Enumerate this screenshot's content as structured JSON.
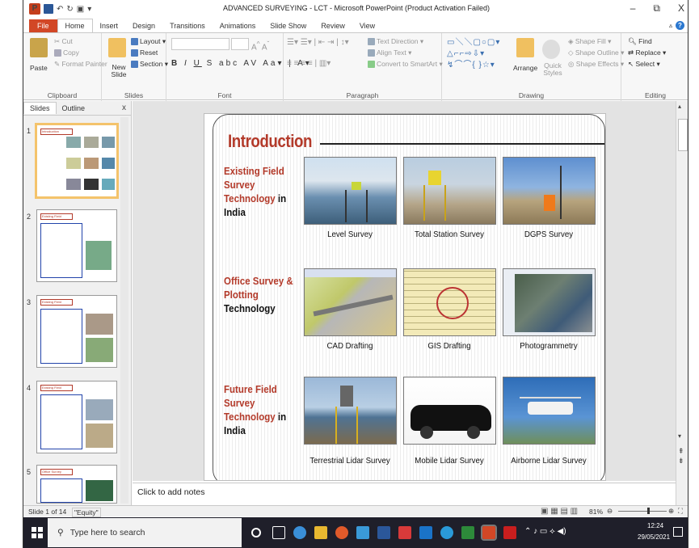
{
  "window": {
    "title": "ADVANCED SURVEYING - LCT - Microsoft PowerPoint (Product Activation Failed)",
    "minimize": "–",
    "restore": "⧉",
    "close": "X"
  },
  "tabs": [
    "File",
    "Home",
    "Insert",
    "Design",
    "Transitions",
    "Animations",
    "Slide Show",
    "Review",
    "View"
  ],
  "ribbon": {
    "clipboard": {
      "paste": "Paste",
      "cut": "Cut",
      "copy": "Copy",
      "format_painter": "Format Painter",
      "label": "Clipboard"
    },
    "slides": {
      "new_slide": "New Slide",
      "layout": "Layout",
      "reset": "Reset",
      "section": "Section",
      "label": "Slides"
    },
    "font": {
      "label": "Font",
      "grow": "A",
      "shrink": "A"
    },
    "paragraph": {
      "label": "Paragraph",
      "text_direction": "Text Direction",
      "align_text": "Align Text",
      "convert_smartart": "Convert to SmartArt"
    },
    "drawing": {
      "label": "Drawing",
      "arrange": "Arrange",
      "quick_styles": "Quick Styles",
      "shape_fill": "Shape Fill",
      "shape_outline": "Shape Outline",
      "shape_effects": "Shape Effects"
    },
    "editing": {
      "label": "Editing",
      "find": "Find",
      "replace": "Replace",
      "select": "Select"
    }
  },
  "panel": {
    "tabs": [
      "Slides",
      "Outline"
    ],
    "close": "x",
    "thumbnails": [
      {
        "num": "1",
        "title": "Introduction"
      },
      {
        "num": "2",
        "title": "Existing Field Survey"
      },
      {
        "num": "3",
        "title": "Existing Field Survey"
      },
      {
        "num": "4",
        "title": "Existing Field Survey"
      },
      {
        "num": "5",
        "title": "Office Survey"
      }
    ]
  },
  "slide": {
    "title": "Introduction",
    "rows": [
      {
        "label_red": "Existing Field Survey Technology",
        "label_black": " in India",
        "items": [
          {
            "caption": "Level Survey",
            "icon": "level-survey-photo"
          },
          {
            "caption": "Total Station Survey",
            "icon": "total-station-photo"
          },
          {
            "caption": "DGPS Survey",
            "icon": "dgps-survey-photo"
          }
        ]
      },
      {
        "label_red": "Office Survey & Plotting",
        "label_black": " Technology",
        "items": [
          {
            "caption": "CAD Drafting",
            "icon": "cad-drafting-image"
          },
          {
            "caption": "GIS Drafting",
            "icon": "gis-drafting-image"
          },
          {
            "caption": "Photogrammetry",
            "icon": "photogrammetry-image"
          }
        ]
      },
      {
        "label_red": "Future Field Survey Technology",
        "label_black": " in India",
        "items": [
          {
            "caption": "Terrestrial Lidar Survey",
            "icon": "terrestrial-lidar-photo"
          },
          {
            "caption": "Mobile Lidar Survey",
            "icon": "mobile-lidar-photo"
          },
          {
            "caption": "Airborne Lidar Survey",
            "icon": "airborne-lidar-photo"
          }
        ]
      }
    ]
  },
  "notes": {
    "placeholder": "Click to add notes"
  },
  "status": {
    "slide_info": "Slide 1 of 14",
    "theme": "\"Equity\"",
    "zoom": "81%"
  },
  "taskbar": {
    "search_placeholder": "Type here to search",
    "time": "12:24",
    "date": "29/05/2021"
  }
}
